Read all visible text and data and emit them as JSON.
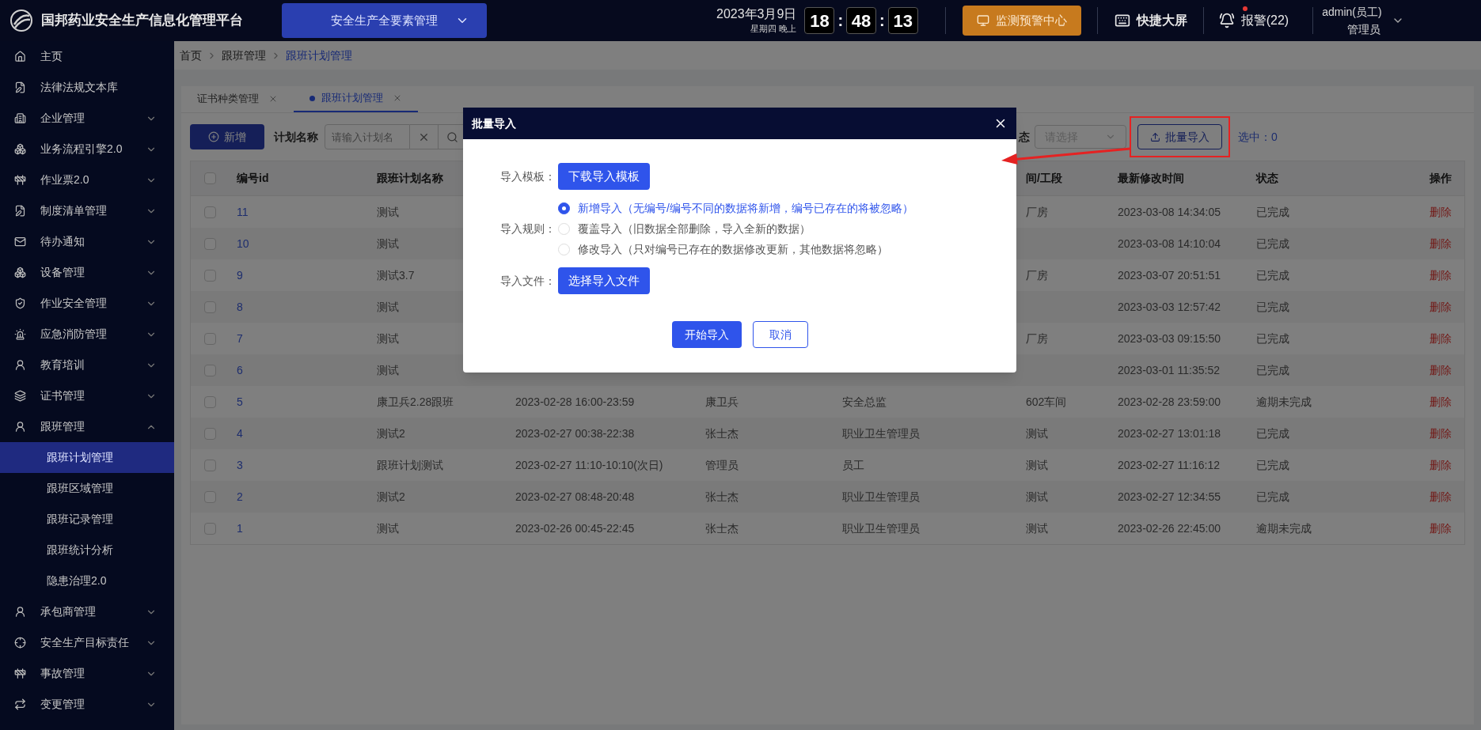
{
  "header": {
    "title": "国邦药业安全生产信息化管理平台",
    "module_select": "安全生产全要素管理",
    "date": "2023年3月9日",
    "weekday": "星期四 晚上",
    "clock": [
      "18",
      "48",
      "13"
    ],
    "clock_separators": [
      ":",
      ":"
    ],
    "monitor_button": "监测预警中心",
    "big_screen": "快捷大屏",
    "alarm": {
      "label": "报警(22)",
      "has_new": true
    },
    "user": {
      "name": "admin(员工)",
      "role": "管理员"
    }
  },
  "sidebar": {
    "items": [
      {
        "label": "主页",
        "selected": false
      },
      {
        "label": "法律法规文本库",
        "selected": false
      },
      {
        "label": "企业管理",
        "selected": false,
        "expanded": false
      },
      {
        "label": "业务流程引擎2.0",
        "selected": false,
        "expanded": false
      },
      {
        "label": "作业票2.0",
        "selected": false,
        "expanded": false
      },
      {
        "label": "制度清单管理",
        "selected": false,
        "expanded": false
      },
      {
        "label": "待办通知",
        "selected": false,
        "expanded": false
      },
      {
        "label": "设备管理",
        "selected": false,
        "expanded": false
      },
      {
        "label": "作业安全管理",
        "selected": false,
        "expanded": false
      },
      {
        "label": "应急消防管理",
        "selected": false,
        "expanded": false
      },
      {
        "label": "教育培训",
        "selected": false,
        "expanded": false
      },
      {
        "label": "证书管理",
        "selected": false,
        "expanded": false
      },
      {
        "label": "跟班管理",
        "selected": false,
        "expanded": true,
        "children": [
          {
            "label": "跟班计划管理",
            "selected": true
          },
          {
            "label": "跟班区域管理",
            "selected": false
          },
          {
            "label": "跟班记录管理",
            "selected": false
          },
          {
            "label": "跟班统计分析",
            "selected": false
          },
          {
            "label": "隐患治理2.0",
            "selected": false
          }
        ]
      },
      {
        "label": "承包商管理",
        "selected": false,
        "expanded": false
      },
      {
        "label": "安全生产目标责任",
        "selected": false,
        "expanded": false
      },
      {
        "label": "事故管理",
        "selected": false,
        "expanded": false
      },
      {
        "label": "变更管理",
        "selected": false,
        "expanded": false
      }
    ]
  },
  "breadcrumb": [
    "首页",
    "跟班管理",
    "跟班计划管理"
  ],
  "tabs": [
    {
      "label": "证书种类管理",
      "selected": false
    },
    {
      "label": "跟班计划管理",
      "selected": true
    }
  ],
  "toolbar": {
    "add_button": "新增",
    "name_label": "计划名称",
    "name_placeholder": "请输入计划名",
    "status_label": "态",
    "status_placeholder": "请选择",
    "import_button": "批量导入",
    "selected_count": "选中：0"
  },
  "table": {
    "all_checked": false,
    "columns": {
      "id": "编号id",
      "name": "跟班计划名称",
      "column_6": "间/工段",
      "modified": "最新修改时间",
      "status": "状态",
      "action": "操作"
    },
    "rows": [
      {
        "checked": false,
        "id": "11",
        "name": "测试",
        "column_6": "厂房",
        "modified": "2023-03-08 14:34:05",
        "status": "已完成",
        "action": "删除"
      },
      {
        "checked": false,
        "id": "10",
        "name": "测试",
        "modified": "2023-03-08 14:10:04",
        "status": "已完成",
        "action": "删除"
      },
      {
        "checked": false,
        "id": "9",
        "name": "测试3.7",
        "column_6": "厂房",
        "modified": "2023-03-07 20:51:51",
        "status": "已完成",
        "action": "删除"
      },
      {
        "checked": false,
        "id": "8",
        "name": "测试",
        "modified": "2023-03-03 12:57:42",
        "status": "已完成",
        "action": "删除"
      },
      {
        "checked": false,
        "id": "7",
        "name": "测试",
        "column_6": "厂房",
        "modified": "2023-03-03 09:15:50",
        "status": "已完成",
        "action": "删除"
      },
      {
        "checked": false,
        "id": "6",
        "name": "测试",
        "modified": "2023-03-01 11:35:52",
        "status": "已完成",
        "action": "删除"
      },
      {
        "checked": false,
        "id": "5",
        "name": "康卫兵2.28跟班",
        "column_3": "2023-02-28 16:00-23:59",
        "column_4": "康卫兵",
        "column_5": "安全总监",
        "column_6": "602车间",
        "modified": "2023-02-28 23:59:00",
        "status": "逾期未完成",
        "action": "删除"
      },
      {
        "checked": false,
        "id": "4",
        "name": "测试2",
        "column_3": "2023-02-27 00:38-22:38",
        "column_4": "张士杰",
        "column_5": "职业卫生管理员",
        "column_6": "测试",
        "modified": "2023-02-27 13:01:18",
        "status": "已完成",
        "action": "删除"
      },
      {
        "checked": false,
        "id": "3",
        "name": "跟班计划测试",
        "column_3": "2023-02-27 11:10-10:10(次日)",
        "column_4": "管理员",
        "column_5": "员工",
        "column_6": "测试",
        "modified": "2023-02-27 11:16:12",
        "status": "已完成",
        "action": "删除"
      },
      {
        "checked": false,
        "id": "2",
        "name": "测试2",
        "column_3": "2023-02-27 08:48-20:48",
        "column_4": "张士杰",
        "column_5": "职业卫生管理员",
        "column_6": "测试",
        "modified": "2023-02-27 12:34:55",
        "status": "已完成",
        "action": "删除"
      },
      {
        "checked": false,
        "id": "1",
        "name": "测试",
        "column_3": "2023-02-26 00:45-22:45",
        "column_4": "张士杰",
        "column_5": "职业卫生管理员",
        "column_6": "测试",
        "modified": "2023-02-26 22:45:00",
        "status": "逾期未完成",
        "action": "删除"
      }
    ]
  },
  "dialog": {
    "title": "批量导入",
    "template_label": "导入模板：",
    "template_button": "下载导入模板",
    "rules_label": "导入规则：",
    "rules": [
      {
        "label": "新增导入（无编号/编号不同的数据将新增，编号已存在的将被忽略）",
        "selected": true
      },
      {
        "label": "覆盖导入（旧数据全部删除，导入全新的数据）",
        "selected": false
      },
      {
        "label": "修改导入（只对编号已存在的数据修改更新，其他数据将忽略）",
        "selected": false
      }
    ],
    "file_label": "导入文件：",
    "file_button": "选择导入文件",
    "confirm_button": "开始导入",
    "cancel_button": "取消"
  }
}
